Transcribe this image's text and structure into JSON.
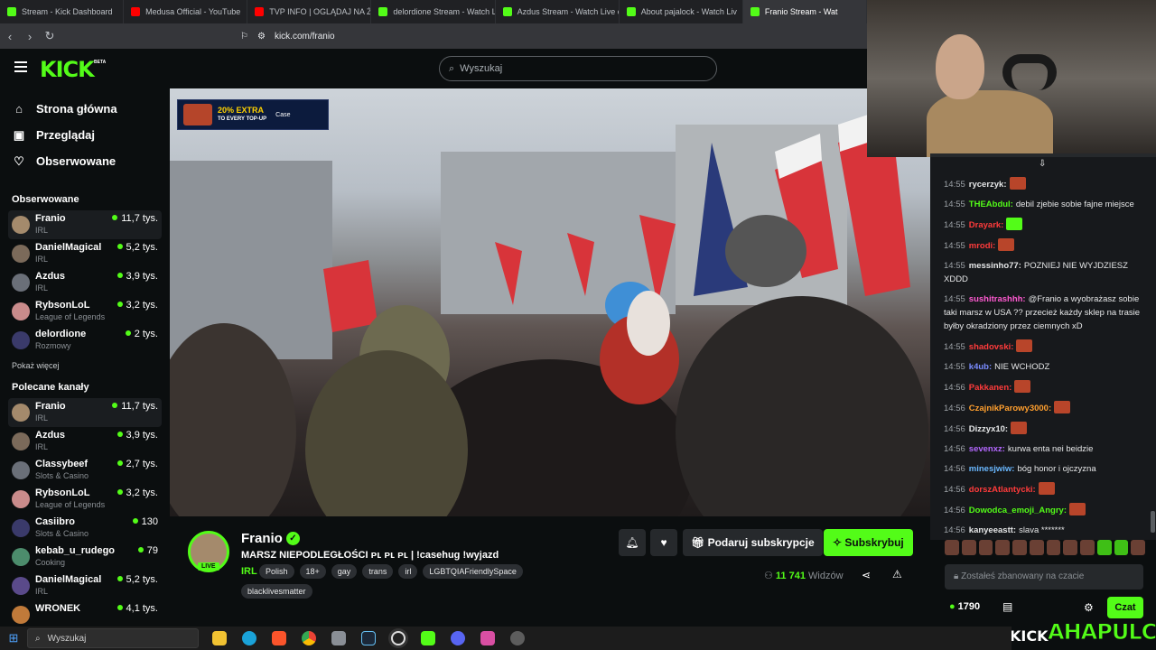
{
  "browser": {
    "tabs": [
      {
        "label": "Stream - Kick Dashboard",
        "favicon": "kick-icon"
      },
      {
        "label": "Medusa Official - YouTube",
        "favicon": "youtube-icon"
      },
      {
        "label": "TVP INFO | OGLĄDAJ NA ŻYW",
        "favicon": "youtube-icon"
      },
      {
        "label": "delordione Stream - Watch Liv",
        "favicon": "kick-icon"
      },
      {
        "label": "Azdus Stream - Watch Live on",
        "favicon": "kick-icon"
      },
      {
        "label": "About pajalock - Watch Liv",
        "favicon": "kick-icon"
      },
      {
        "label": "Franio Stream - Wat",
        "favicon": "kick-icon",
        "active": true
      }
    ],
    "url": "kick.com/franio"
  },
  "header": {
    "logo": "KICK",
    "logo_badge": "BETA",
    "search_placeholder": "Wyszukaj"
  },
  "sidebar": {
    "nav": [
      {
        "label": "Strona główna",
        "icon": "home-icon"
      },
      {
        "label": "Przeglądaj",
        "icon": "browse-icon"
      },
      {
        "label": "Obserwowane",
        "icon": "heart-icon"
      }
    ],
    "followed_title": "Obserwowane",
    "followed": [
      {
        "name": "Franio",
        "category": "IRL",
        "viewers": "11,7 tys.",
        "selected": true
      },
      {
        "name": "DanielMagical",
        "category": "IRL",
        "viewers": "5,2 tys."
      },
      {
        "name": "Azdus",
        "category": "IRL",
        "viewers": "3,9 tys."
      },
      {
        "name": "RybsonLoL",
        "category": "League of Legends",
        "viewers": "3,2 tys."
      },
      {
        "name": "delordione",
        "category": "Rozmowy",
        "viewers": "2 tys."
      }
    ],
    "show_more": "Pokaż więcej",
    "recommended_title": "Polecane kanały",
    "recommended": [
      {
        "name": "Franio",
        "category": "IRL",
        "viewers": "11,7 tys.",
        "selected": true
      },
      {
        "name": "Azdus",
        "category": "IRL",
        "viewers": "3,9 tys."
      },
      {
        "name": "Classybeef",
        "category": "Slots & Casino",
        "viewers": "2,7 tys."
      },
      {
        "name": "RybsonLoL",
        "category": "League of Legends",
        "viewers": "3,2 tys."
      },
      {
        "name": "Casiibro",
        "category": "Slots & Casino",
        "viewers": "130"
      },
      {
        "name": "kebab_u_rudego",
        "category": "Cooking",
        "viewers": "79"
      },
      {
        "name": "DanielMagical",
        "category": "IRL",
        "viewers": "5,2 tys."
      },
      {
        "name": "WRONEK",
        "category": "",
        "viewers": "4,1 tys."
      }
    ]
  },
  "video": {
    "banner_title": "20% EXTRA",
    "banner_sub": "TO EVERY TOP-UP",
    "banner_brand": "Case"
  },
  "stream": {
    "name": "Franio",
    "live_label": "LIVE",
    "title": "MARSZ NIEPODLEGŁOŚCI ᴘʟ ᴘʟ ᴘʟ  | !casehug !wyjazd",
    "category": "IRL",
    "tags": [
      "Polish",
      "18+",
      "gay",
      "trans",
      "irl",
      "LGBTQIAFriendlySpace"
    ],
    "tags_row2": [
      "blacklivesmatter"
    ],
    "gift_label": "Podaruj subskrypcje",
    "subscribe_label": "Subskrybuj",
    "viewer_count": "11 741",
    "viewers_label": "Widzów"
  },
  "chat": {
    "messages": [
      {
        "time": "14:55",
        "user": "rycerzyk:",
        "color": "#e6e7e8",
        "text": "",
        "emote": "red"
      },
      {
        "time": "14:55",
        "user": "THEAbdul:",
        "color": "#53fc18",
        "text": "debil zjebie sobie fajne miejsce"
      },
      {
        "time": "14:55",
        "user": "Drayark:",
        "color": "#ff3b3b",
        "text": "",
        "emote": "green"
      },
      {
        "time": "14:55",
        "user": "mrodi:",
        "color": "#ff3b3b",
        "text": "",
        "emote": "red"
      },
      {
        "time": "14:55",
        "user": "messinho77:",
        "color": "#e6e7e8",
        "text": "POZNIEJ NIE WYJDZIESZ XDDD"
      },
      {
        "time": "14:55",
        "user": "sushitrashhh:",
        "color": "#ff5ad1",
        "text": "@Franio a wyobrażasz sobie taki marsz w USA ?? przecież każdy sklep na trasie byłby okradziony przez ciemnych xD"
      },
      {
        "time": "14:55",
        "user": "shadovski:",
        "color": "#ff3b3b",
        "text": "",
        "emote": "red"
      },
      {
        "time": "14:55",
        "user": "k4ub:",
        "color": "#7a8cff",
        "text": "NIE WCHODZ"
      },
      {
        "time": "14:56",
        "user": "Pakkanen:",
        "color": "#ff3b3b",
        "text": "",
        "emote": "red"
      },
      {
        "time": "14:56",
        "user": "CzajnikParowy3000:",
        "color": "#ff9f2e",
        "text": "",
        "emote": "red"
      },
      {
        "time": "14:56",
        "user": "Dizzyx10:",
        "color": "#e6e7e8",
        "text": "",
        "emote": "red"
      },
      {
        "time": "14:56",
        "user": "sevenxz:",
        "color": "#b468ff",
        "text": "kurwa enta nei beidzie"
      },
      {
        "time": "14:56",
        "user": "minesjwiw:",
        "color": "#6ab8ff",
        "text": "bóg honor i ojczyzna"
      },
      {
        "time": "14:56",
        "user": "dorszAtlantycki:",
        "color": "#ff3b3b",
        "text": "",
        "emote": "red"
      },
      {
        "time": "14:56",
        "user": "Dowodca_emoji_Angry:",
        "color": "#53fc18",
        "text": "",
        "emote": "red"
      },
      {
        "time": "14:56",
        "user": "kanyeeastt:",
        "color": "#e6e7e8",
        "text": "slava *******"
      }
    ],
    "input_placeholder": "Zostałeś zbanowany na czacie",
    "points": "1790",
    "chat_button": "Czat"
  },
  "watermark": {
    "kick": "KICK",
    "brand": "AHAPULCO"
  },
  "taskbar": {
    "search_label": "Wyszukaj"
  }
}
